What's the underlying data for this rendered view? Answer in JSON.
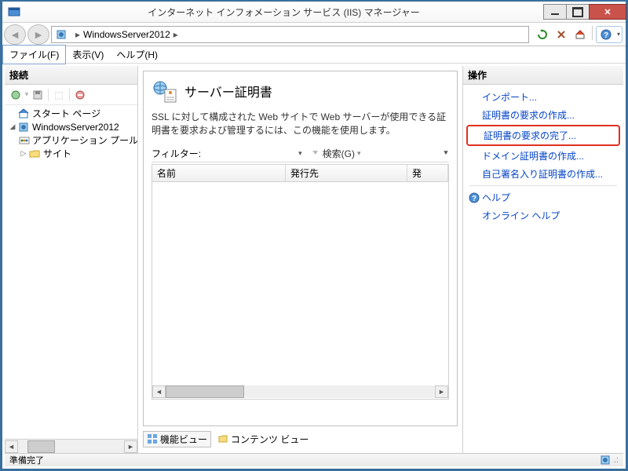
{
  "window": {
    "title": "インターネット インフォメーション サービス (IIS) マネージャー"
  },
  "breadcrumb": {
    "server": "WindowsServer2012"
  },
  "menubar": {
    "file": "ファイル(F)",
    "view": "表示(V)",
    "help": "ヘルプ(H)"
  },
  "panels": {
    "connections": "接続",
    "actions": "操作"
  },
  "tree": {
    "start_page": "スタート ページ",
    "server": "WindowsServer2012",
    "app_pools": "アプリケーション プール",
    "sites": "サイト"
  },
  "center": {
    "title": "サーバー証明書",
    "description": "SSL に対して構成された Web サイトで Web サーバーが使用できる証明書を要求および管理するには、この機能を使用します。",
    "filter_label": "フィルター:",
    "filter_value": "",
    "search_label": "検索(G)",
    "columns": {
      "name": "名前",
      "issued_to": "発行先",
      "issuer_short": "発"
    }
  },
  "views": {
    "features": "機能ビュー",
    "content": "コンテンツ ビュー"
  },
  "actions": {
    "import": "インポート...",
    "create_request": "証明書の要求の作成...",
    "complete_request": "証明書の要求の完了...",
    "create_domain_cert": "ドメイン証明書の作成...",
    "create_self_signed": "自己署名入り証明書の作成...",
    "help": "ヘルプ",
    "online_help": "オンライン ヘルプ"
  },
  "status": {
    "ready": "準備完了"
  }
}
